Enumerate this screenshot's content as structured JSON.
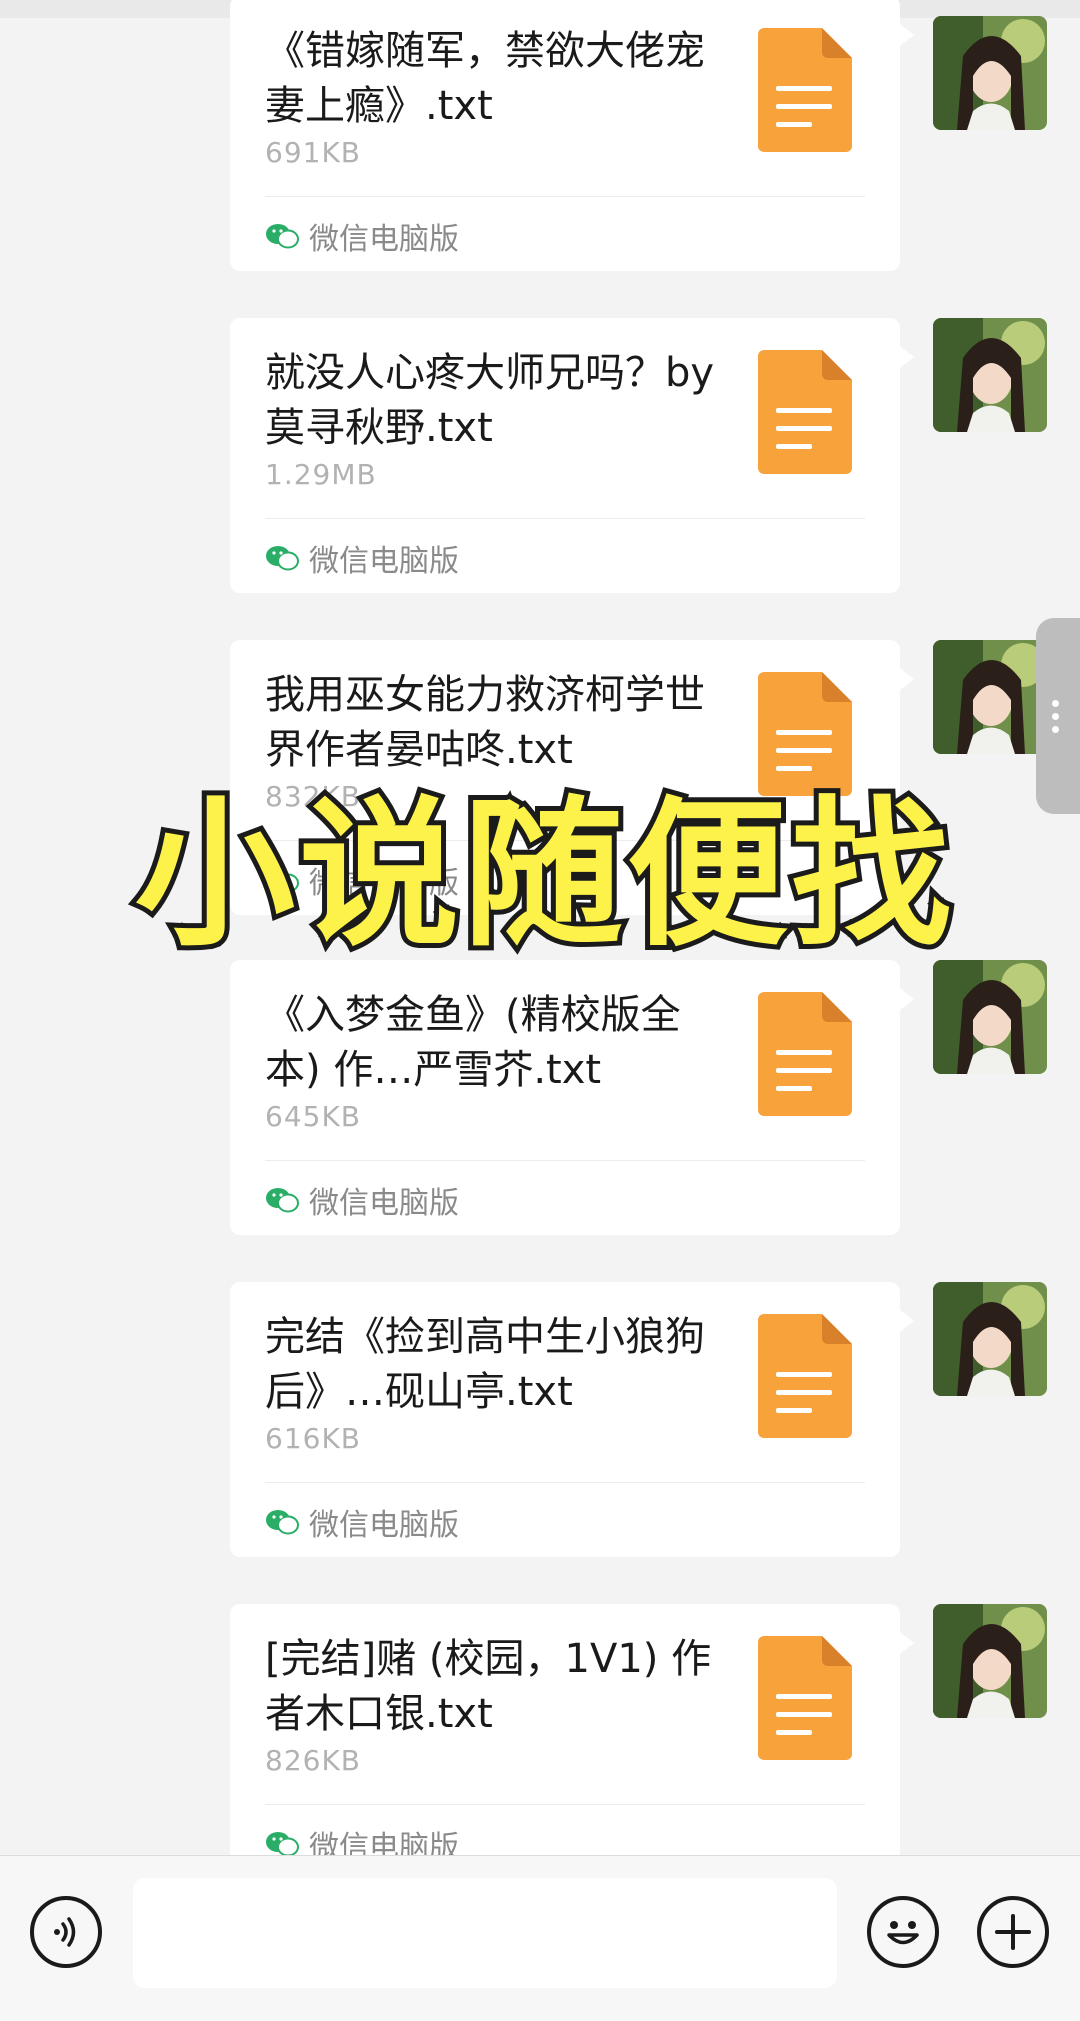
{
  "overlay": {
    "title": "小说随便找"
  },
  "messages": [
    {
      "file_name": "《错嫁随军，禁欲大佬宠妻上瘾》.txt",
      "size": "691KB",
      "source": "微信电脑版"
    },
    {
      "file_name": "就没人心疼大师兄吗？by莫寻秋野.txt",
      "size": "1.29MB",
      "source": "微信电脑版"
    },
    {
      "file_name": "我用巫女能力救济柯学世界作者晏咕咚.txt",
      "size": "832KB",
      "source": "微信电脑版"
    },
    {
      "file_name": "《入梦金鱼》(精校版全本) 作…严雪芥.txt",
      "size": "645KB",
      "source": "微信电脑版"
    },
    {
      "file_name": "完结《捡到高中生小狼狗后》…砚山亭.txt",
      "size": "616KB",
      "source": "微信电脑版"
    },
    {
      "file_name": "[完结]赌 (校园，1V1) 作者木口银.txt",
      "size": "826KB",
      "source": "微信电脑版"
    }
  ],
  "input_bar": {
    "voice_icon": "voice-icon",
    "emoji_icon": "emoji-icon",
    "plus_icon": "plus-icon"
  },
  "colors": {
    "file_icon": "#f7a23b",
    "overlay_text": "#fdf24a",
    "wechat_green": "#2aae67"
  }
}
